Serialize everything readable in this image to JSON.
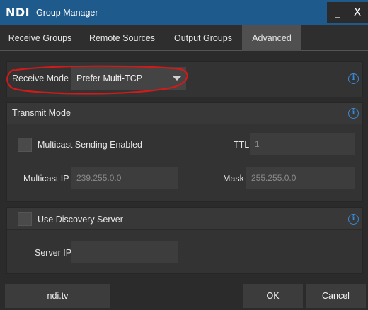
{
  "titlebar": {
    "logo": "NDI",
    "title": "Group Manager",
    "minimize": "_",
    "close": "X"
  },
  "tabs": [
    {
      "label": "Receive Groups",
      "active": false
    },
    {
      "label": "Remote Sources",
      "active": false
    },
    {
      "label": "Output Groups",
      "active": false
    },
    {
      "label": "Advanced",
      "active": true
    }
  ],
  "receive": {
    "label": "Receive Mode",
    "selected": "Prefer Multi-TCP",
    "info": "i"
  },
  "transmit": {
    "title": "Transmit Mode",
    "info": "i",
    "multicast_label": "Multicast Sending Enabled",
    "multicast_checked": false,
    "ttl_label": "TTL",
    "ttl_value": "1",
    "ip_label": "Multicast IP",
    "ip_value": "239.255.0.0",
    "mask_label": "Mask",
    "mask_value": "255.255.0.0"
  },
  "discovery": {
    "label": "Use Discovery Server",
    "checked": false,
    "info": "i",
    "server_label": "Server IP",
    "server_value": ""
  },
  "footer": {
    "link": "ndi.tv",
    "ok": "OK",
    "cancel": "Cancel"
  },
  "colors": {
    "titlebar": "#1e5a8c",
    "background": "#2b2b2b",
    "info": "#3a8ad6",
    "annotation": "#d11a1a"
  }
}
